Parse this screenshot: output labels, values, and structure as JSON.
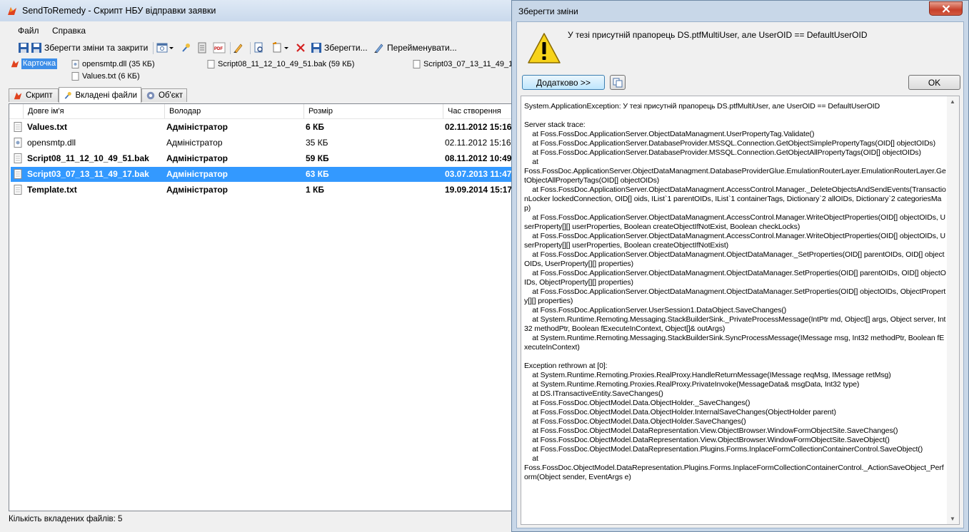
{
  "main": {
    "title": "SendToRemedy - Скрипт НБУ відправки заявки",
    "menu": [
      "Файл",
      "Справка"
    ],
    "toolbar": {
      "save_close_label": "Зберегти зміни та закрити",
      "save_label": "Зберегти...",
      "rename_label": "Перейменувати..."
    },
    "card_label": "Карточка",
    "attachments": [
      "opensmtp.dll (35 КБ)",
      "Values.txt (6 КБ)",
      "Script08_11_12_10_49_51.bak (59 КБ)",
      "Script03_07_13_11_49_1"
    ],
    "tabs": [
      "Скрипт",
      "Вкладені файли",
      "Об'єкт"
    ],
    "columns": [
      "Довге ім'я",
      "Володар",
      "Розмір",
      "Час створення"
    ],
    "rows": [
      {
        "name": "Values.txt",
        "owner": "Адміністратор",
        "size": "6 КБ",
        "created": "02.11.2012 15:16",
        "bold": true,
        "selected": false
      },
      {
        "name": "opensmtp.dll",
        "owner": "Адміністратор",
        "size": "35 КБ",
        "created": "02.11.2012 15:16:09",
        "bold": false,
        "selected": false
      },
      {
        "name": "Script08_11_12_10_49_51.bak",
        "owner": "Адміністратор",
        "size": "59 КБ",
        "created": "08.11.2012 10:49",
        "bold": true,
        "selected": false
      },
      {
        "name": "Script03_07_13_11_49_17.bak",
        "owner": "Адміністратор",
        "size": "63 КБ",
        "created": "03.07.2013 11:47",
        "bold": true,
        "selected": true
      },
      {
        "name": "Template.txt",
        "owner": "Адміністратор",
        "size": "1 КБ",
        "created": "19.09.2014 15:17",
        "bold": true,
        "selected": false
      }
    ],
    "status": "Кількість вкладених файлів: 5"
  },
  "dialog": {
    "title": "Зберегти зміни",
    "message": "У тезі присутній прапорець DS.ptfMultiUser, але UserOID == DefaultUserOID",
    "details_button": "Додатково >>",
    "ok_button": "OK",
    "details": "System.ApplicationException: У тезі присутній прапорець DS.ptfMultiUser, але UserOID == DefaultUserOID\n\nServer stack trace:\n    at Foss.FossDoc.ApplicationServer.ObjectDataManagment.UserPropertyTag.Validate()\n    at Foss.FossDoc.ApplicationServer.DatabaseProvider.MSSQL.Connection.GetObjectSimplePropertyTags(OID[] objectOIDs)\n    at Foss.FossDoc.ApplicationServer.DatabaseProvider.MSSQL.Connection.GetObjectAllPropertyTags(OID[] objectOIDs)\n    at\nFoss.FossDoc.ApplicationServer.ObjectDataManagment.DatabaseProviderGlue.EmulationRouterLayer.EmulationRouterLayer.GetObjectAllPropertyTags(OID[] objectOIDs)\n    at Foss.FossDoc.ApplicationServer.ObjectDataManagment.AccessControl.Manager._DeleteObjectsAndSendEvents(TransactionLocker lockedConnection, OID[] oids, IList`1 parentOIDs, IList`1 containerTags, Dictionary`2 allOIDs, Dictionary`2 categoriesMap)\n    at Foss.FossDoc.ApplicationServer.ObjectDataManagment.AccessControl.Manager.WriteObjectProperties(OID[] objectOIDs, UserProperty[][] userProperties, Boolean createObjectIfNotExist, Boolean checkLocks)\n    at Foss.FossDoc.ApplicationServer.ObjectDataManagment.AccessControl.Manager.WriteObjectProperties(OID[] objectOIDs, UserProperty[][] userProperties, Boolean createObjectIfNotExist)\n    at Foss.FossDoc.ApplicationServer.ObjectDataManagment.ObjectDataManager._SetProperties(OID[] parentOIDs, OID[] objectOIDs, UserProperty[][] properties)\n    at Foss.FossDoc.ApplicationServer.ObjectDataManagment.ObjectDataManager.SetProperties(OID[] parentOIDs, OID[] objectOIDs, ObjectProperty[][] properties)\n    at Foss.FossDoc.ApplicationServer.ObjectDataManagment.ObjectDataManager.SetProperties(OID[] objectOIDs, ObjectProperty[][] properties)\n    at Foss.FossDoc.ApplicationServer.UserSession1.DataObject.SaveChanges()\n    at System.Runtime.Remoting.Messaging.StackBuilderSink._PrivateProcessMessage(IntPtr md, Object[] args, Object server, Int32 methodPtr, Boolean fExecuteInContext, Object[]& outArgs)\n    at System.Runtime.Remoting.Messaging.StackBuilderSink.SyncProcessMessage(IMessage msg, Int32 methodPtr, Boolean fExecuteInContext)\n\nException rethrown at [0]:\n    at System.Runtime.Remoting.Proxies.RealProxy.HandleReturnMessage(IMessage reqMsg, IMessage retMsg)\n    at System.Runtime.Remoting.Proxies.RealProxy.PrivateInvoke(MessageData& msgData, Int32 type)\n    at DS.ITransactiveEntity.SaveChanges()\n    at Foss.FossDoc.ObjectModel.Data.ObjectHolder._SaveChanges()\n    at Foss.FossDoc.ObjectModel.Data.ObjectHolder.InternalSaveChanges(ObjectHolder parent)\n    at Foss.FossDoc.ObjectModel.Data.ObjectHolder.SaveChanges()\n    at Foss.FossDoc.ObjectModel.DataRepresentation.View.ObjectBrowser.WindowFormObjectSite.SaveChanges()\n    at Foss.FossDoc.ObjectModel.DataRepresentation.View.ObjectBrowser.WindowFormObjectSite.SaveObject()\n    at Foss.FossDoc.ObjectModel.DataRepresentation.Plugins.Forms.InplaceFormCollectionContainerControl.SaveObject()\n    at\nFoss.FossDoc.ObjectModel.DataRepresentation.Plugins.Forms.InplaceFormCollectionContainerControl._ActionSaveObject_Perform(Object sender, EventArgs e)"
  },
  "colors": {
    "selection": "#3399ff",
    "title_gradient_top": "#dfe9f5",
    "close_red": "#c7402a",
    "card_highlight": "#3d8ee8"
  },
  "icons": [
    "app-icon",
    "save-icon",
    "dropdown-icon",
    "attach-icon",
    "pdf-icon",
    "delete-icon",
    "rename-icon",
    "warning-icon",
    "copy-icon",
    "file-icon",
    "dll-icon",
    "close-icon"
  ]
}
